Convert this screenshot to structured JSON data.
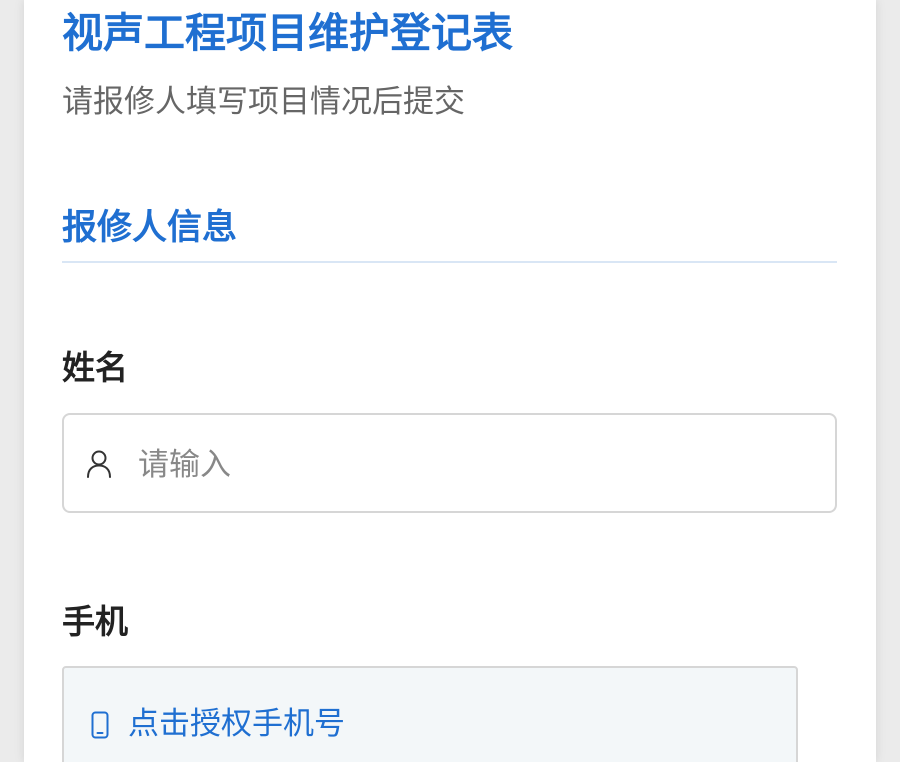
{
  "form": {
    "title": "视声工程项目维护登记表",
    "subtitle": "请报修人填写项目情况后提交"
  },
  "section": {
    "title": "报修人信息"
  },
  "name_field": {
    "label": "姓名",
    "placeholder": "请输入",
    "value": "",
    "icon": "user-icon"
  },
  "phone_field": {
    "label": "手机",
    "button_label": "点击授权手机号",
    "icon": "mobile-phone-icon"
  },
  "colors": {
    "accent": "#1f6fd1",
    "subtitle": "#666666",
    "label": "#222222",
    "border": "#d6d6d6",
    "phone_button_bg": "#f3f7f9",
    "page_bg": "#ebebeb"
  }
}
